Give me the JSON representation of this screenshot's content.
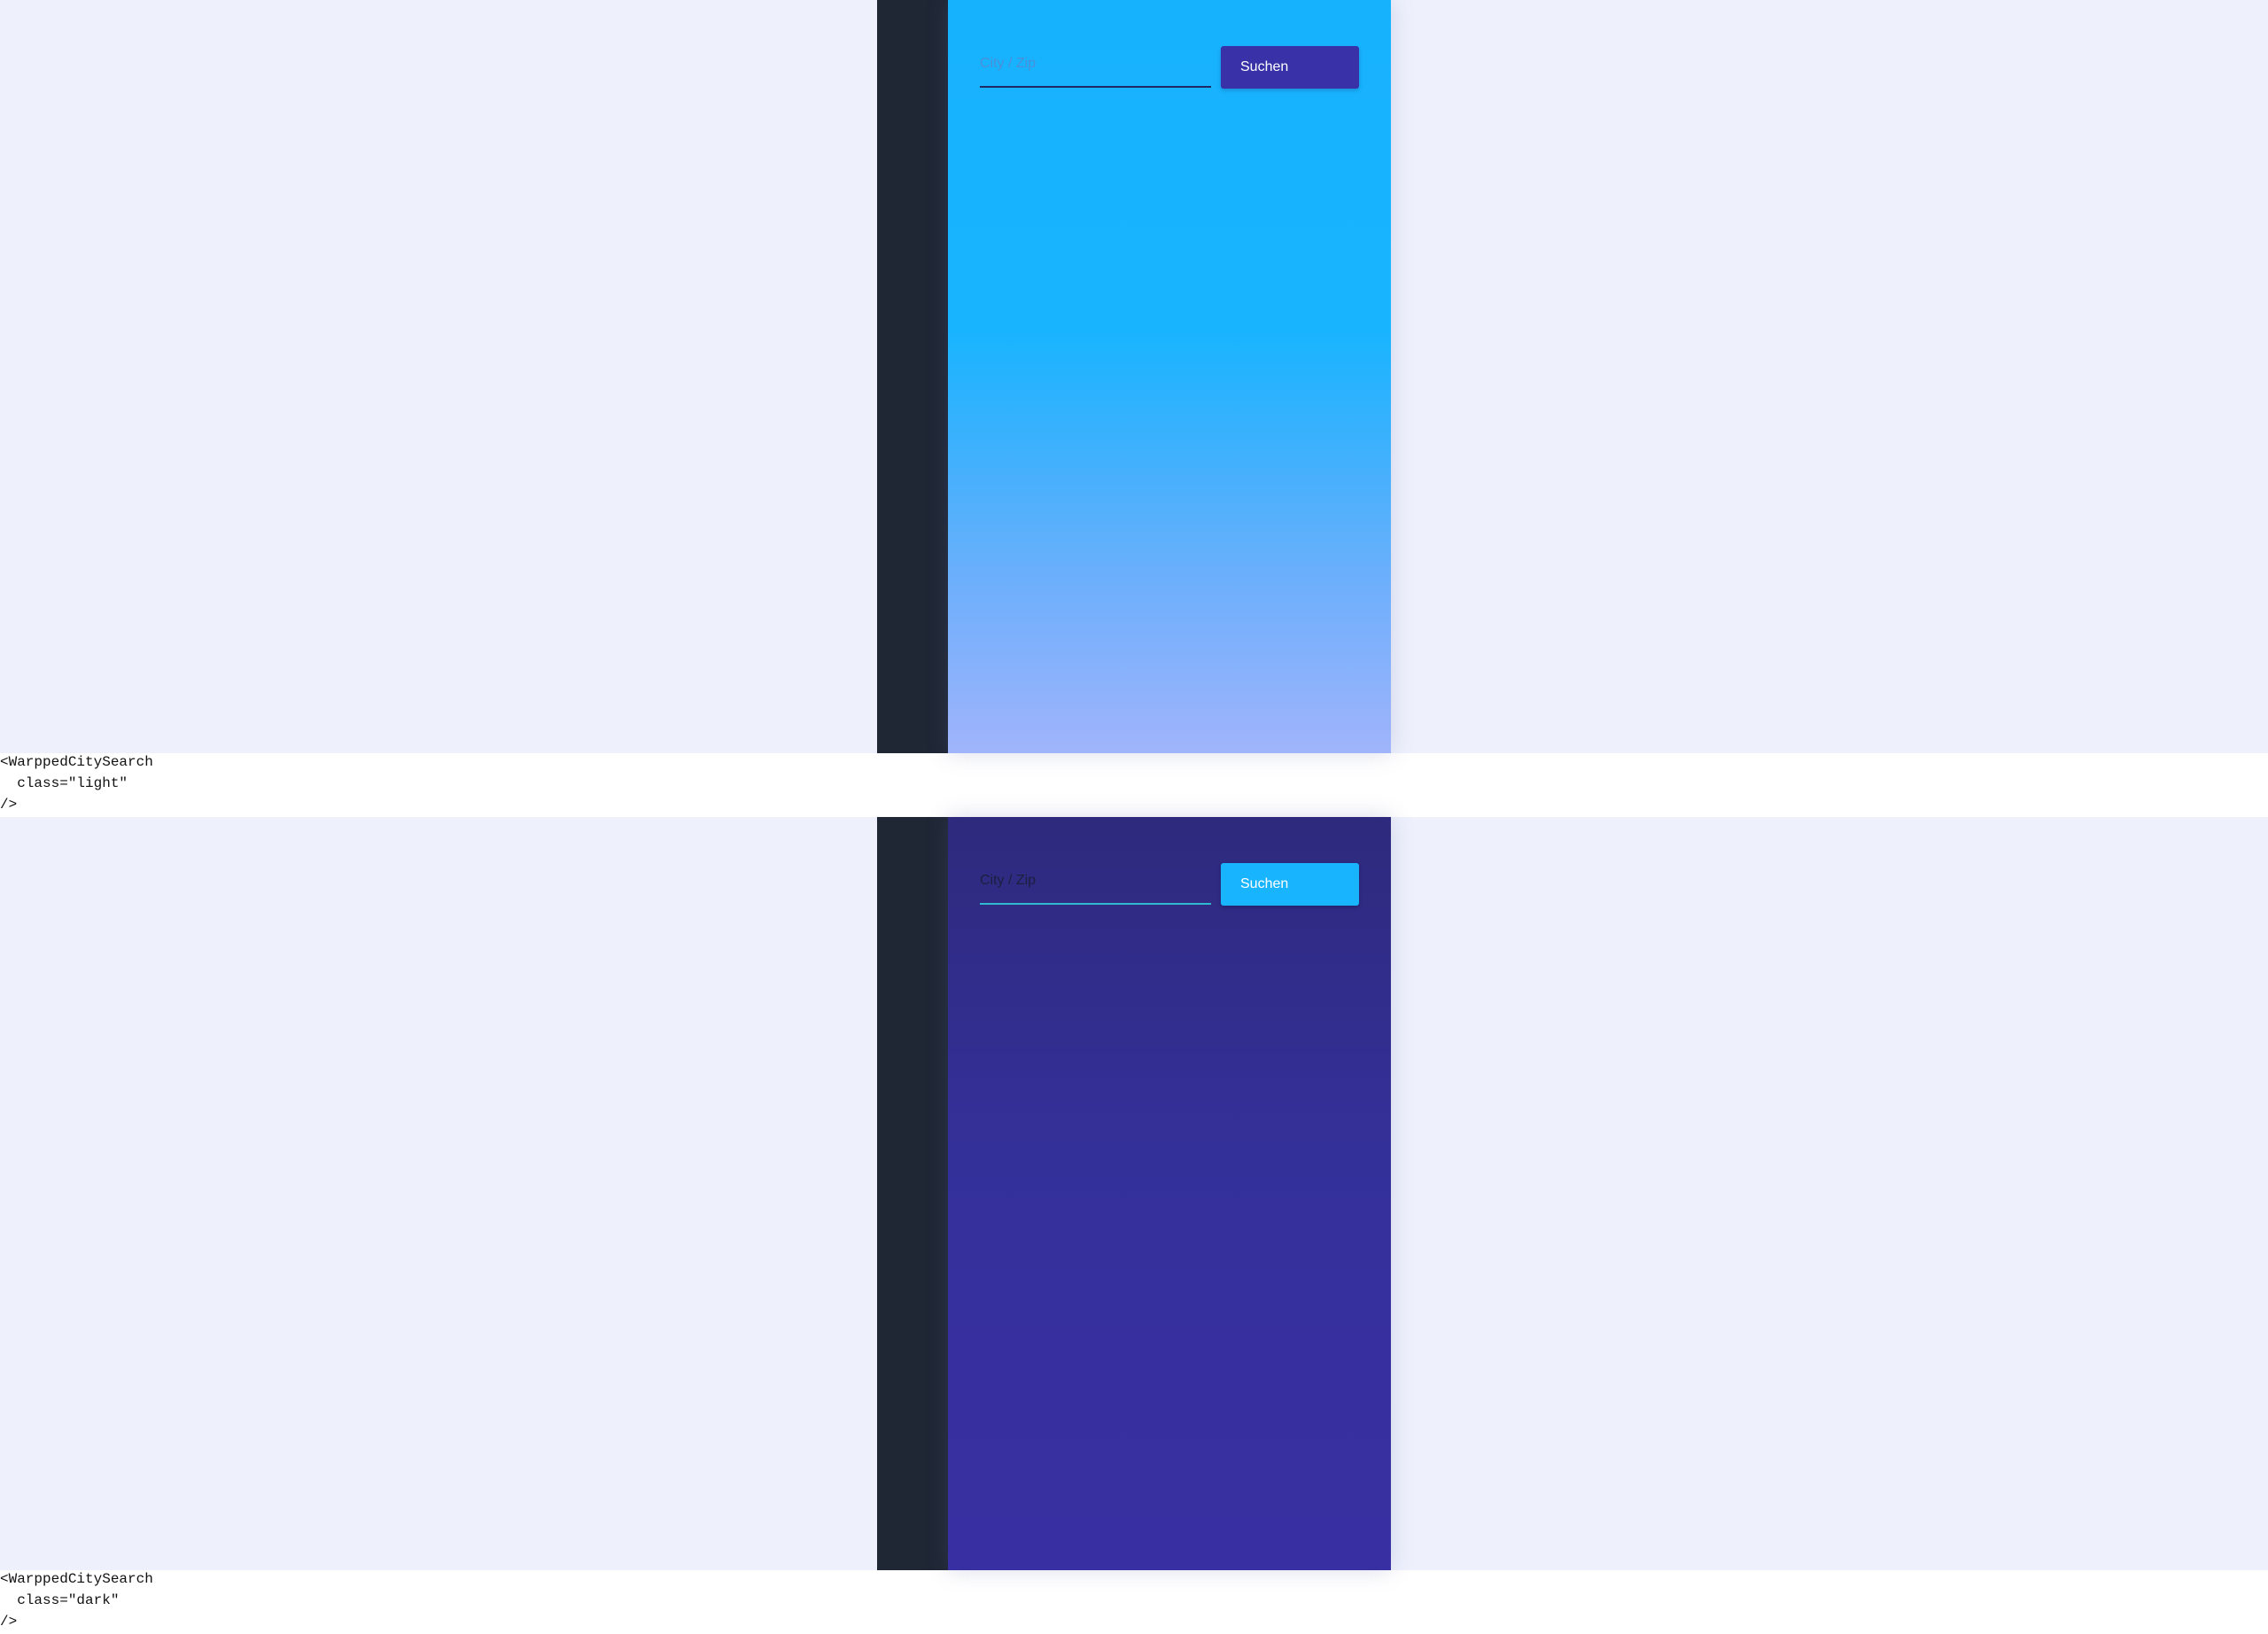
{
  "examples": [
    {
      "theme": "light",
      "search": {
        "placeholder": "City / Zip",
        "value": "",
        "button_label": "Suchen"
      },
      "code_lines": [
        "<WarppedCitySearch",
        "  class=\"light\"",
        "/>"
      ]
    },
    {
      "theme": "dark",
      "search": {
        "placeholder": "City / Zip",
        "value": "",
        "button_label": "Suchen"
      },
      "code_lines": [
        "<WarppedCitySearch",
        "  class=\"dark\"",
        "/>"
      ]
    }
  ],
  "colors": {
    "preview_background": "#eef1fc",
    "sidebar": "#1f2735",
    "light_panel_top": "#17b2fe",
    "light_panel_bottom": "#a0b4fb",
    "light_button": "#3831a8",
    "dark_panel_top": "#2e2a7d",
    "dark_panel_bottom": "#3830a2",
    "dark_button": "#19b4fe"
  }
}
